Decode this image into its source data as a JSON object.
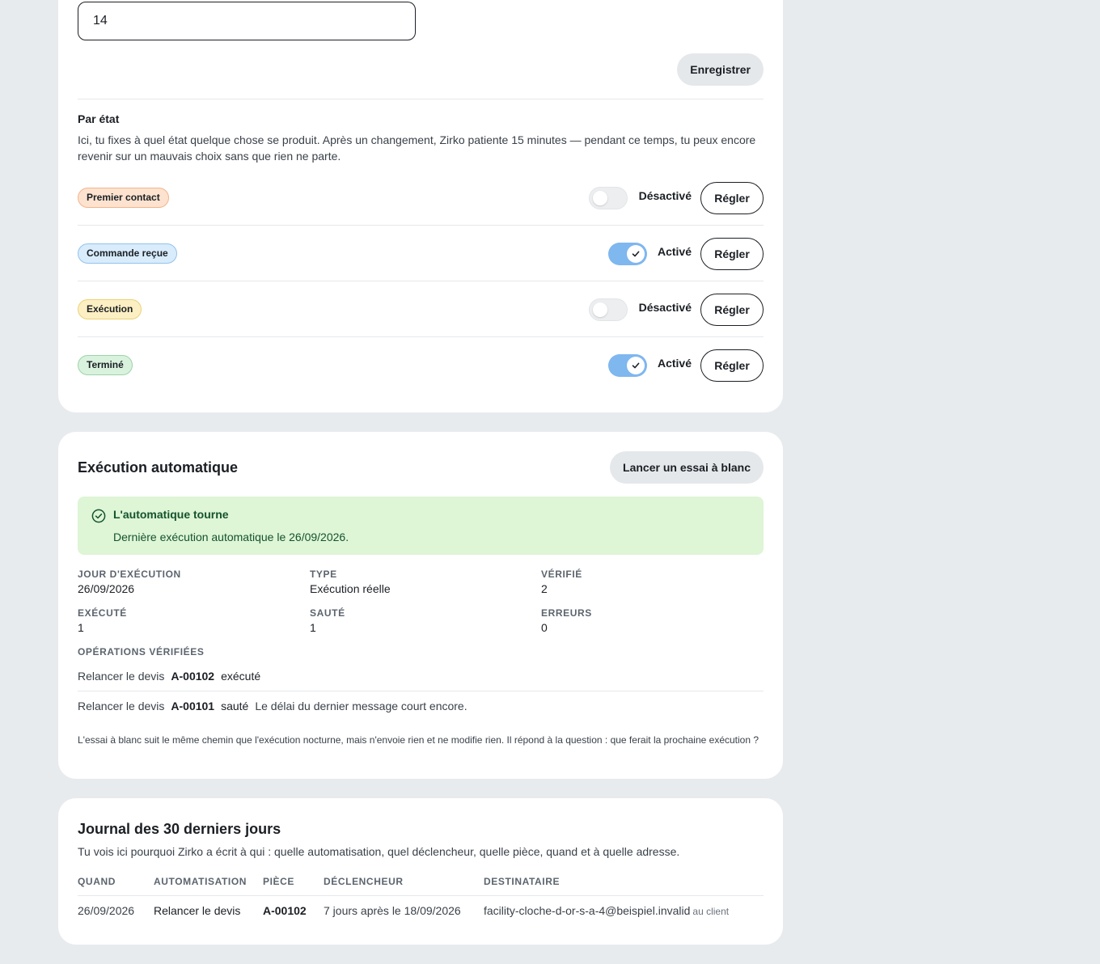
{
  "settings": {
    "number_value": "14",
    "save_label": "Enregistrer",
    "section_title": "Par état",
    "section_desc": "Ici, tu fixes à quel état quelque chose se produit. Après un changement, Zirko patiente 15 minutes — pendant ce temps, tu peux encore revenir sur un mauvais choix sans que rien ne parte.",
    "states": [
      {
        "label": "Premier contact",
        "status": "Désactivé",
        "enabled": false,
        "button": "Régler"
      },
      {
        "label": "Commande reçue",
        "status": "Activé",
        "enabled": true,
        "button": "Régler"
      },
      {
        "label": "Exécution",
        "status": "Désactivé",
        "enabled": false,
        "button": "Régler"
      },
      {
        "label": "Terminé",
        "status": "Activé",
        "enabled": true,
        "button": "Régler"
      }
    ]
  },
  "auto": {
    "title": "Exécution automatique",
    "dry_run_label": "Lancer un essai à blanc",
    "alert_title": "L'automatique tourne",
    "alert_text": "Dernière exécution automatique le 26/09/2026.",
    "stats": [
      {
        "key": "Jour d'exécution",
        "value": "26/09/2026"
      },
      {
        "key": "Type",
        "value": "Exécution réelle"
      },
      {
        "key": "Vérifié",
        "value": "2"
      },
      {
        "key": "Exécuté",
        "value": "1"
      },
      {
        "key": "Sauté",
        "value": "1"
      },
      {
        "key": "Erreurs",
        "value": "0"
      }
    ],
    "ops_label": "OPÉRATIONS VÉRIFIÉES",
    "ops": [
      {
        "action": "Relancer le devis",
        "ref": "A-00102",
        "status": "exécuté",
        "note": ""
      },
      {
        "action": "Relancer le devis",
        "ref": "A-00101",
        "status": "sauté",
        "note": "Le délai du dernier message court encore."
      }
    ],
    "footnote": "L'essai à blanc suit le même chemin que l'exécution nocturne, mais n'envoie rien et ne modifie rien. Il répond à la question : que ferait la prochaine exécution ?"
  },
  "journal": {
    "title": "Journal des 30 derniers jours",
    "desc": "Tu vois ici pourquoi Zirko a écrit à qui : quelle automatisation, quel déclencheur, quelle pièce, quand et à quelle adresse.",
    "columns": [
      "QUAND",
      "AUTOMATISATION",
      "PIÈCE",
      "DÉCLENCHEUR",
      "DESTINATAIRE"
    ],
    "rows": [
      {
        "when": "26/09/2026",
        "automation": "Relancer le devis",
        "piece": "A-00102",
        "trigger": "7 jours après le 18/09/2026",
        "recipient": "facility-cloche-d-or-s-a-4@beispiel.invalid",
        "recipient_note": "au client"
      }
    ]
  },
  "colors": {
    "page_bg": "#e8ebee",
    "toggle_on": "#7fb7ef",
    "alert_bg": "#def5d6",
    "alert_text": "#14532d"
  }
}
